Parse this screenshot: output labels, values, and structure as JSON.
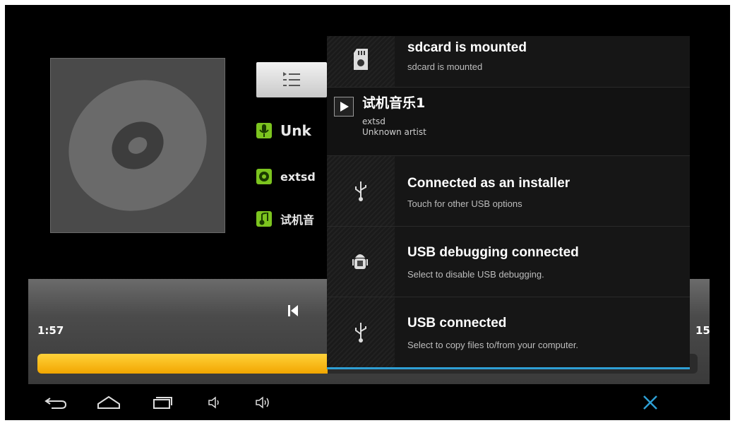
{
  "player": {
    "artist": "Unk",
    "album": "extsd",
    "track": "试机音",
    "time_elapsed": "1:57",
    "time_total": "15",
    "progress": 0.44
  },
  "notifications": [
    {
      "title": "sdcard is mounted",
      "subtitle": "sdcard is mounted",
      "icon": "sdcard-icon"
    },
    {
      "title": "试机音乐1",
      "line1": "extsd",
      "line2": "Unknown artist",
      "icon": "play-icon"
    },
    {
      "title": "Connected as an installer",
      "subtitle": "Touch for other USB options",
      "icon": "usb-icon"
    },
    {
      "title": "USB debugging connected",
      "subtitle": "Select to disable USB debugging.",
      "icon": "android-debug-icon"
    },
    {
      "title": "USB connected",
      "subtitle": "Select to copy files to/from your computer.",
      "icon": "usb-icon"
    }
  ],
  "colors": {
    "accent_blue": "#2e9fd4",
    "progress_yellow": "#f2a600",
    "icon_green": "#7cc41f"
  },
  "navbar": {
    "icons": [
      "back-icon",
      "home-icon",
      "recent-apps-icon",
      "volume-down-icon",
      "volume-up-icon",
      "close-icon"
    ]
  }
}
